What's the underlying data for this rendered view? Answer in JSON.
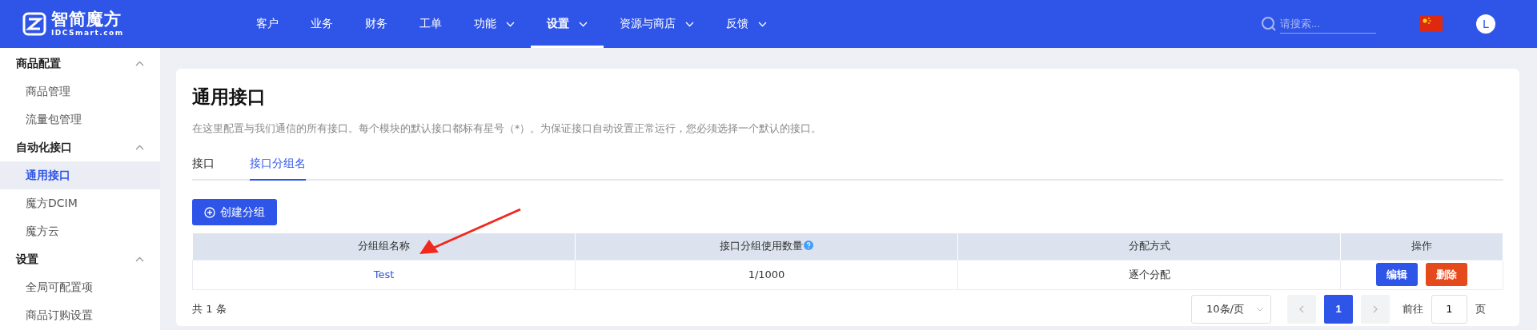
{
  "logo": {
    "name": "智简魔方",
    "domain": "IDCSmart.com"
  },
  "nav": [
    {
      "label": "客户",
      "dropdown": false,
      "selected": false
    },
    {
      "label": "业务",
      "dropdown": false,
      "selected": false
    },
    {
      "label": "财务",
      "dropdown": false,
      "selected": false
    },
    {
      "label": "工单",
      "dropdown": false,
      "selected": false
    },
    {
      "label": "功能",
      "dropdown": true,
      "selected": false
    },
    {
      "label": "设置",
      "dropdown": true,
      "selected": true
    },
    {
      "label": "资源与商店",
      "dropdown": true,
      "selected": false
    },
    {
      "label": "反馈",
      "dropdown": true,
      "selected": false
    }
  ],
  "search": {
    "placeholder": "请搜索..."
  },
  "user": {
    "initial": "L"
  },
  "sidebar": [
    {
      "label": "商品配置",
      "expanded": true,
      "children": [
        {
          "label": "商品管理",
          "selected": false
        },
        {
          "label": "流量包管理",
          "selected": false
        }
      ]
    },
    {
      "label": "自动化接口",
      "expanded": true,
      "children": [
        {
          "label": "通用接口",
          "selected": true
        },
        {
          "label": "魔方DCIM",
          "selected": false
        },
        {
          "label": "魔方云",
          "selected": false
        }
      ]
    },
    {
      "label": "设置",
      "expanded": true,
      "children": [
        {
          "label": "全局可配置项",
          "selected": false
        },
        {
          "label": "商品订购设置",
          "selected": false
        }
      ]
    }
  ],
  "page": {
    "title": "通用接口",
    "description": "在这里配置与我们通信的所有接口。每个模块的默认接口都标有星号（*）。为保证接口自动设置正常运行，您必须选择一个默认的接口。"
  },
  "tabs": [
    {
      "label": "接口",
      "selected": false
    },
    {
      "label": "接口分组名",
      "selected": true
    }
  ],
  "create_button": "创建分组",
  "table": {
    "columns": [
      {
        "label": "分组组名称",
        "help": false
      },
      {
        "label": "接口分组使用数量",
        "help": true
      },
      {
        "label": "分配方式",
        "help": false
      },
      {
        "label": "操作",
        "help": false
      }
    ],
    "rows": [
      {
        "name": "Test",
        "usage": "1/1000",
        "method": "逐个分配",
        "actions": [
          {
            "label": "编辑",
            "kind": "edit"
          },
          {
            "label": "删除",
            "kind": "delete"
          }
        ]
      }
    ]
  },
  "pagination": {
    "total": "共 1 条",
    "page_size": "10条/页",
    "pages": [
      {
        "label": "1",
        "selected": true
      }
    ],
    "goto_label": "前往",
    "goto_value": "1",
    "page_unit": "页"
  }
}
